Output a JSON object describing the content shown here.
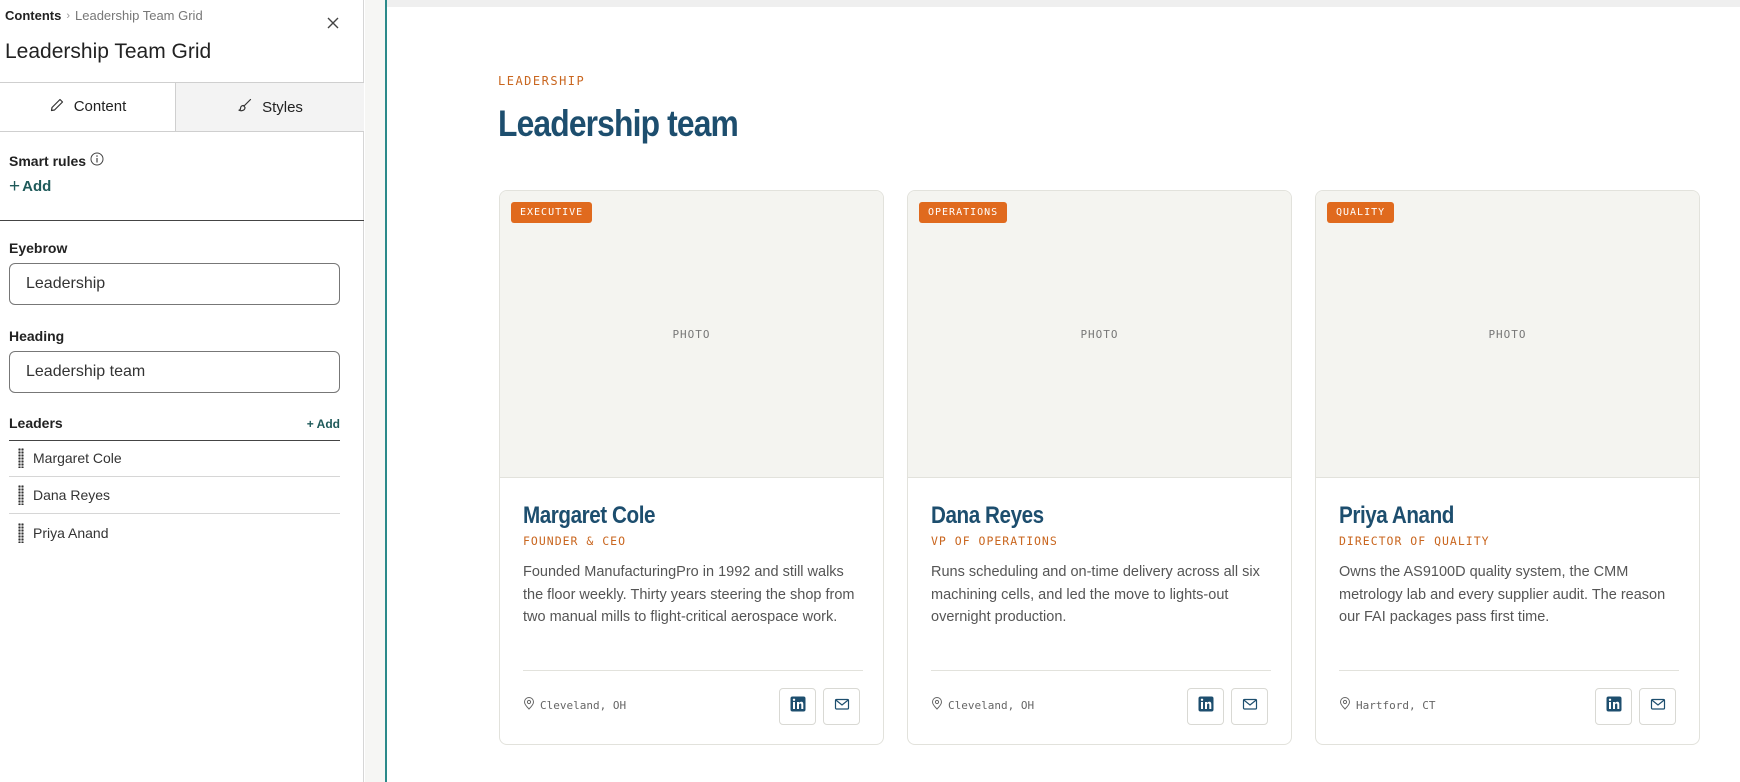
{
  "panel": {
    "breadcrumb_root": "Contents",
    "breadcrumb_separator": "›",
    "breadcrumb_current": "Leadership Team Grid",
    "title": "Leadership Team Grid",
    "tabs": [
      {
        "label": "Content",
        "icon": "pencil-icon",
        "active": true
      },
      {
        "label": "Styles",
        "icon": "brush-icon",
        "active": false
      }
    ],
    "smart_rules_label": "Smart rules",
    "smart_rules_add": "Add",
    "eyebrow_label": "Eyebrow",
    "eyebrow_value": "Leadership",
    "heading_label": "Heading",
    "heading_value": "Leadership team",
    "leaders_label": "Leaders",
    "leaders_add": "+ Add",
    "leaders": [
      "Margaret Cole",
      "Dana Reyes",
      "Priya Anand"
    ]
  },
  "preview": {
    "eyebrow": "Leadership",
    "heading": "Leadership team",
    "photo_placeholder": "PHOTO",
    "cards": [
      {
        "badge": "EXECUTIVE",
        "name": "Margaret Cole",
        "role": "FOUNDER & CEO",
        "bio": "Founded ManufacturingPro in 1992 and still walks the floor weekly. Thirty years steering the shop from two manual mills to flight-critical aerospace work.",
        "location": "Cleveland, OH"
      },
      {
        "badge": "OPERATIONS",
        "name": "Dana Reyes",
        "role": "VP OF OPERATIONS",
        "bio": "Runs scheduling and on-time delivery across all six machining cells, and led the move to lights-out overnight production.",
        "location": "Cleveland, OH"
      },
      {
        "badge": "QUALITY",
        "name": "Priya Anand",
        "role": "DIRECTOR OF QUALITY",
        "bio": "Owns the AS9100D quality system, the CMM metrology lab and every supplier audit. The reason our FAI packages pass first time.",
        "location": "Hartford, CT"
      }
    ]
  },
  "colors": {
    "accent_teal": "#1f5a5a",
    "heading_navy": "#1d4e6e",
    "eyebrow_orange": "#c9661f",
    "badge_orange": "#e06a1e"
  }
}
